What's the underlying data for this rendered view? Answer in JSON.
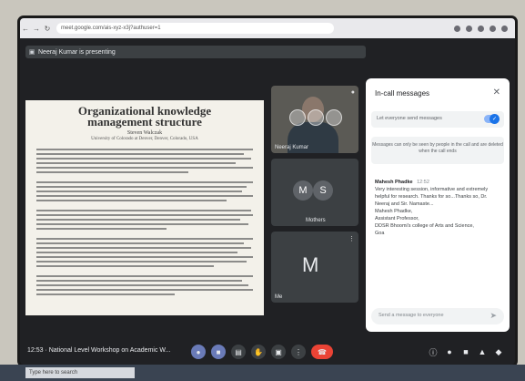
{
  "browser": {
    "url": "meet.google.com/ais-xyz-x3j?authuser=1",
    "back_icon": "back-icon",
    "forward_icon": "forward-icon",
    "reload_icon": "reload-icon"
  },
  "meet": {
    "presenting_text": "Neeraj Kumar is presenting",
    "slide": {
      "title_line1": "Organizational knowledge",
      "title_line2": "management structure",
      "author": "Steven Walczak",
      "affiliation": "University of Colorado at Denver, Denver, Colorado, USA"
    },
    "tiles": {
      "video_name": "Neeraj Kumar",
      "ms_initials": [
        "M",
        "S"
      ],
      "ms_name": "Mothers",
      "m_letter": "M",
      "m_name": "Me"
    }
  },
  "panel": {
    "title": "In-call messages",
    "toggle_label": "Let everyone send messages",
    "notice": "Messages can only be seen by people in the call and are deleted when the call ends",
    "message": {
      "sender": "Mahesh Phadke",
      "time": "12:52",
      "lines": [
        "Very interesting session, informative and extremely",
        "helpful for research. Thanks for so...Thanks so, Dr.",
        "Neeraj and Sir. Namaste...",
        "Mahesh Phadke,",
        "Assistant Professor,",
        "DDSR Bhoomi's college of Arts and Science,",
        "Goa"
      ]
    },
    "send_placeholder": "Send a message to everyone"
  },
  "controls": {
    "meeting_label": "12:53 · National Level Workshop on Academic W..."
  },
  "taskbar": {
    "search_text": "Type here to search"
  }
}
